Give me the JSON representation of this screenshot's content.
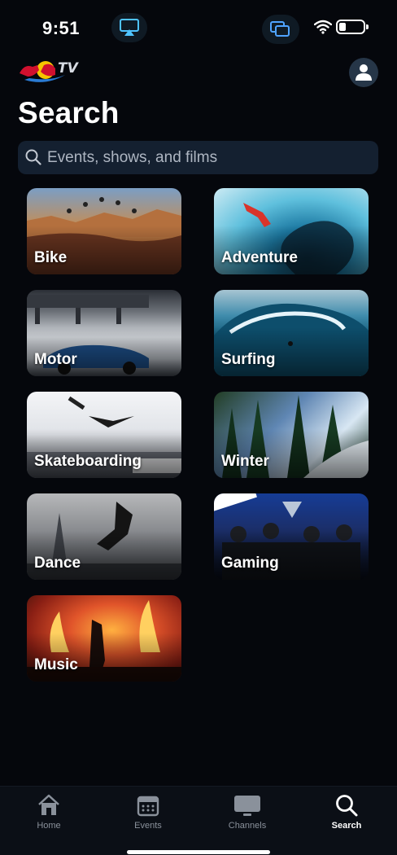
{
  "status_bar": {
    "time": "9:51"
  },
  "header": {
    "logo_text": "TV",
    "title": "Search"
  },
  "search": {
    "placeholder": "Events, shows, and films"
  },
  "categories": [
    {
      "label": "Bike"
    },
    {
      "label": "Adventure"
    },
    {
      "label": "Motor"
    },
    {
      "label": "Surfing"
    },
    {
      "label": "Skateboarding"
    },
    {
      "label": "Winter"
    },
    {
      "label": "Dance"
    },
    {
      "label": "Gaming"
    },
    {
      "label": "Music"
    }
  ],
  "tab_bar": {
    "tabs": [
      {
        "label": "Home",
        "icon": "home-icon"
      },
      {
        "label": "Events",
        "icon": "calendar-icon"
      },
      {
        "label": "Channels",
        "icon": "tv-icon"
      },
      {
        "label": "Search",
        "icon": "search-icon"
      }
    ],
    "active": "Search"
  },
  "colors": {
    "background": "#05070c",
    "search_field": "#142030",
    "avatar": "#263648",
    "tab_bar": "#0b0f16",
    "inactive_tab": "#8a919b"
  }
}
